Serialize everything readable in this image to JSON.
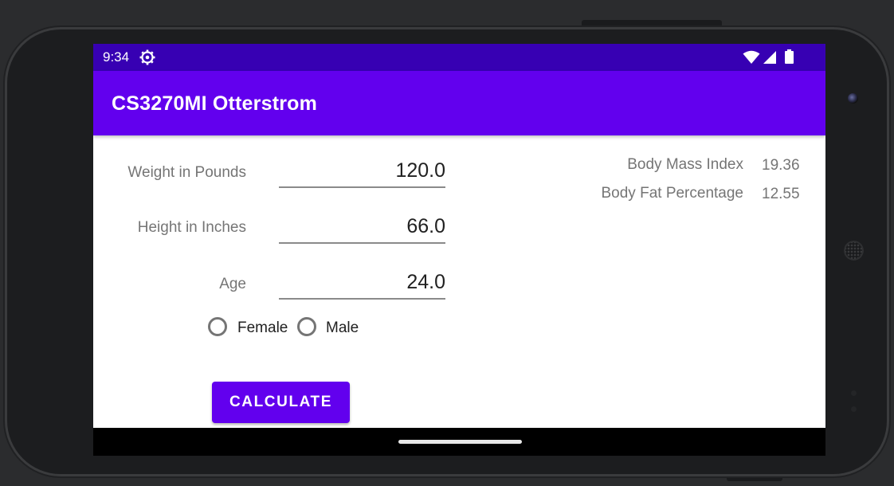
{
  "status_bar": {
    "time": "9:34",
    "icons": [
      "gear-icon",
      "wifi-icon",
      "signal-icon",
      "battery-icon"
    ]
  },
  "app_bar": {
    "title": "CS3270MI Otterstrom"
  },
  "form": {
    "weight": {
      "label": "Weight in Pounds",
      "value": "120.0"
    },
    "height": {
      "label": "Height in Inches",
      "value": "66.0"
    },
    "age": {
      "label": "Age",
      "value": "24.0"
    },
    "sex_options": [
      {
        "label": "Female",
        "checked": false
      },
      {
        "label": "Male",
        "checked": false
      }
    ],
    "calculate_label": "CALCULATE"
  },
  "results": {
    "bmi": {
      "label": "Body Mass Index",
      "value": "19.36"
    },
    "body_fat": {
      "label": "Body Fat Percentage",
      "value": "12.55"
    }
  },
  "colors": {
    "primary": "#6200ee",
    "primary_dark": "#3700b3",
    "label_gray": "#757575"
  }
}
